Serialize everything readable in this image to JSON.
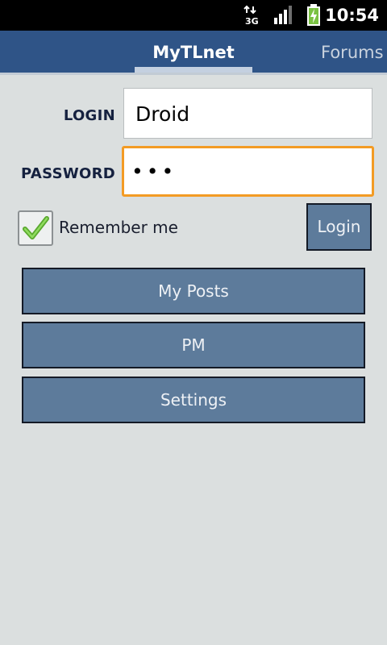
{
  "status_bar": {
    "network": "3G",
    "time": "10:54",
    "icons": [
      "data-arrows-3g-icon",
      "signal-bars-icon",
      "battery-charging-icon"
    ]
  },
  "tabs": [
    {
      "label": "MyTLnet",
      "selected": true
    },
    {
      "label": "Forums",
      "selected": false
    }
  ],
  "form": {
    "login_label": "LOGIN",
    "login_value": "Droid",
    "password_label": "PASSWORD",
    "password_value": "•••",
    "remember_label": "Remember me",
    "remember_checked": true,
    "login_button": "Login"
  },
  "menu": {
    "my_posts": "My Posts",
    "pm": "PM",
    "settings": "Settings"
  },
  "colors": {
    "tab_bar": "#2f5487",
    "background": "#dbdfdf",
    "button": "#5d7b9b",
    "focus_border": "#f39b24",
    "check": "#6cc23a"
  }
}
